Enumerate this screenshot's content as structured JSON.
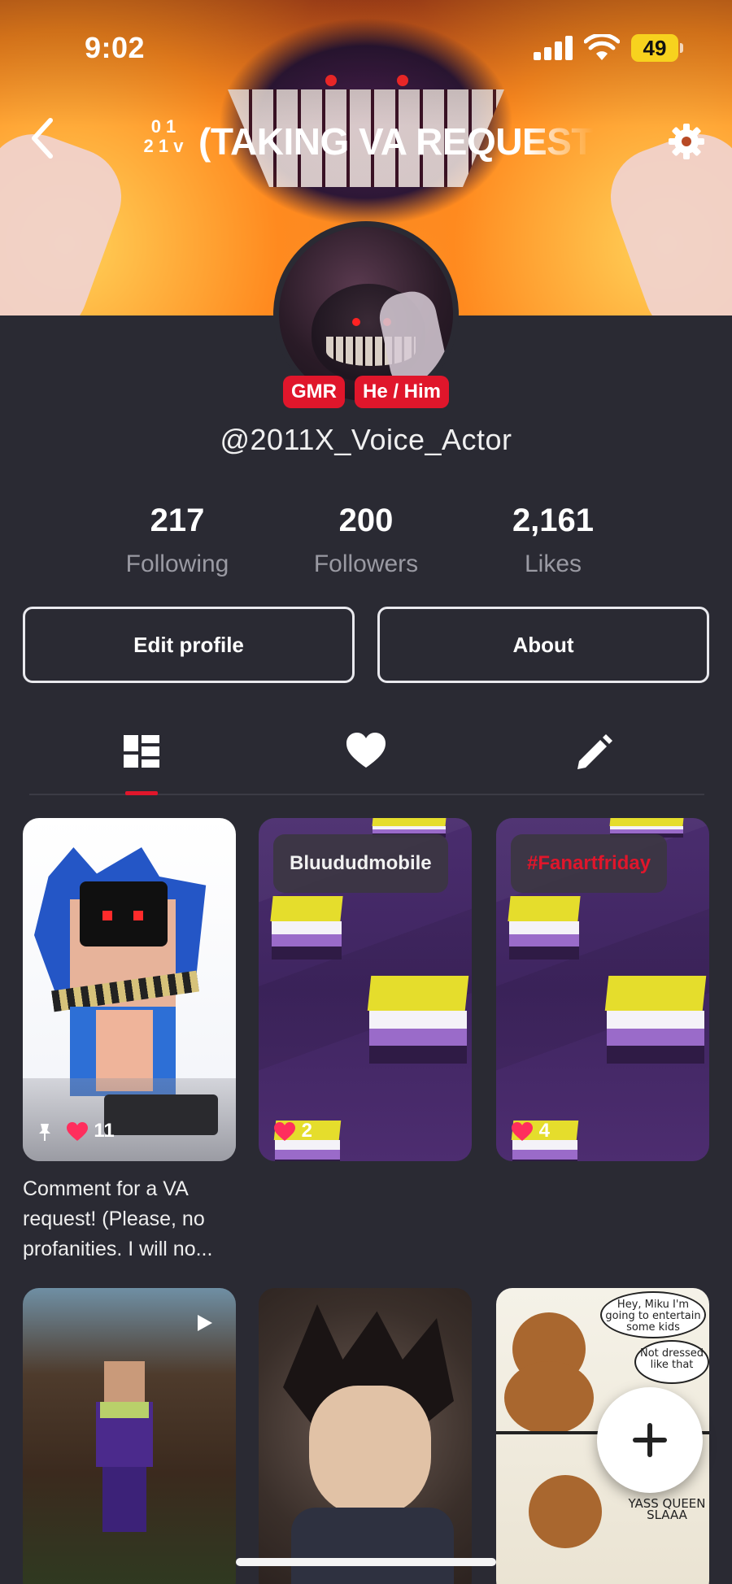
{
  "status_bar": {
    "time": "9:02",
    "battery": "49"
  },
  "header": {
    "title_prefix_line1": "0 1",
    "title_prefix_line2": "2 1 v",
    "title": "(TAKING VA REQUEST"
  },
  "profile": {
    "badges": [
      "GMR",
      "He / Him"
    ],
    "handle": "@2011X_Voice_Actor"
  },
  "stats": [
    {
      "value": "217",
      "label": "Following"
    },
    {
      "value": "200",
      "label": "Followers"
    },
    {
      "value": "2,161",
      "label": "Likes"
    }
  ],
  "buttons": {
    "edit_profile": "Edit profile",
    "about": "About"
  },
  "tabs": [
    {
      "icon": "grid-icon",
      "active": true
    },
    {
      "icon": "heart-icon",
      "active": false
    },
    {
      "icon": "pencil-icon",
      "active": false
    }
  ],
  "posts": [
    {
      "likes": "11",
      "pinned": true,
      "caption": "Comment for a VA request! (Please, no profanities. I will no..."
    },
    {
      "likes": "2",
      "tag": "Bluududmobile"
    },
    {
      "likes": "4",
      "tag": "#Fanartfriday"
    },
    {
      "type": "video"
    },
    {},
    {
      "comic_text_1": "Hey, Miku I'm going to entertain some kids",
      "comic_text_2": "Not dressed like that",
      "comic_text_3": "YASS QUEEN SLAAA"
    }
  ],
  "colors": {
    "accent": "#e0162b",
    "background": "#2a2a33",
    "muted_text": "#9a9aa3"
  }
}
